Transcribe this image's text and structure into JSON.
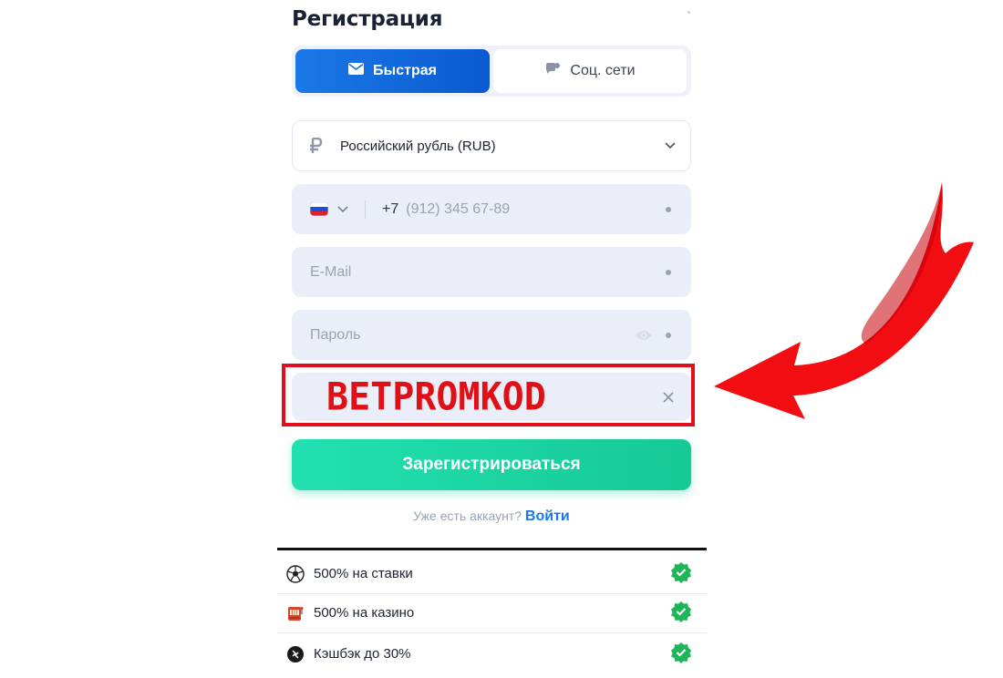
{
  "title": "Регистрация",
  "tabs": [
    {
      "label": "Быстрая",
      "icon": "envelope-icon",
      "active": true
    },
    {
      "label": "Соц. сети",
      "icon": "chat-bubble-icon",
      "active": false
    }
  ],
  "currency": {
    "icon": "ruble-icon",
    "value": "Российский рубль (RUB)"
  },
  "phone": {
    "country_icon": "russia-flag-icon",
    "prefix": "+7",
    "placeholder": "(912) 345 67-89"
  },
  "email": {
    "placeholder": "E-Mail"
  },
  "password": {
    "placeholder": "Пароль"
  },
  "promo": {
    "value": "BETPROMKOD"
  },
  "submit_label": "Зарегистрироваться",
  "login": {
    "prompt": "Уже есть аккаунт?",
    "link": "Войти"
  },
  "benefits": [
    {
      "icon": "soccer-ball-icon",
      "label": "500% на ставки"
    },
    {
      "icon": "slot-machine-icon",
      "label": "500% на казино"
    },
    {
      "icon": "cashback-coin-icon",
      "label": "Кэшбэк до 30%"
    }
  ],
  "colors": {
    "accent_blue": "#0a66dc",
    "accent_green": "#1fd3a5",
    "highlight_red": "#e20e1b",
    "check_green": "#1fb65a"
  }
}
